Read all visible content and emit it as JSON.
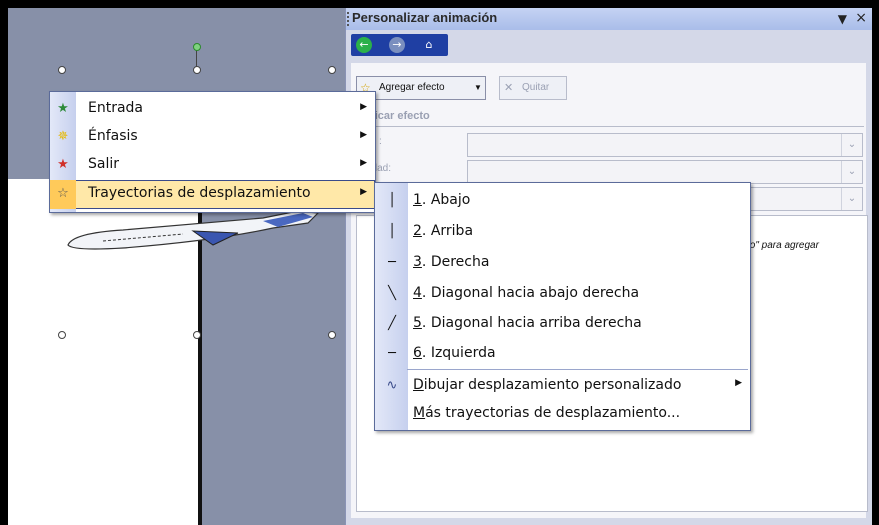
{
  "task_pane": {
    "title": "Personalizar animación",
    "nav": [
      "back-icon",
      "forward-icon",
      "home-icon"
    ],
    "add_effect_label": "Agregar efecto",
    "remove_label": "Quitar",
    "modify_header": "ificar efecto",
    "field1_label": ":",
    "field2_label": "edad:",
    "hint_text": "to\" para agregar"
  },
  "effect_menu": {
    "items": [
      {
        "label": "Entrada",
        "icon": "entrance-star-icon",
        "icon_color": "#2e8b3a",
        "has_submenu": true
      },
      {
        "label": "Énfasis",
        "icon": "emphasis-star-icon",
        "icon_color": "#e6b800",
        "has_submenu": true
      },
      {
        "label": "Salir",
        "icon": "exit-star-icon",
        "icon_color": "#d0302a",
        "has_submenu": true
      },
      {
        "label": "Trayectorias de desplazamiento",
        "icon": "motion-path-star-icon",
        "icon_color": "#888888",
        "has_submenu": true,
        "highlighted": true
      }
    ]
  },
  "path_menu": {
    "items": [
      {
        "num": "1",
        "label": ". Abajo",
        "icon": "│"
      },
      {
        "num": "2",
        "label": ". Arriba",
        "icon": "│"
      },
      {
        "num": "3",
        "label": ". Derecha",
        "icon": "─"
      },
      {
        "num": "4",
        "label": ". Diagonal hacia abajo derecha",
        "icon": "╲"
      },
      {
        "num": "5",
        "label": ". Diagonal hacia arriba derecha",
        "icon": "╱"
      },
      {
        "num": "6",
        "label": ". Izquierda",
        "icon": "─"
      }
    ],
    "custom": {
      "first": "D",
      "rest": "ibujar desplazamiento personalizado",
      "icon": "∿"
    },
    "more": {
      "first": "M",
      "rest": "ás trayectorias de desplazamiento..."
    }
  },
  "colors": {
    "accent": "#1f3fa3",
    "highlight": "#ffe8a8",
    "slide_bg": "#8790a8"
  }
}
